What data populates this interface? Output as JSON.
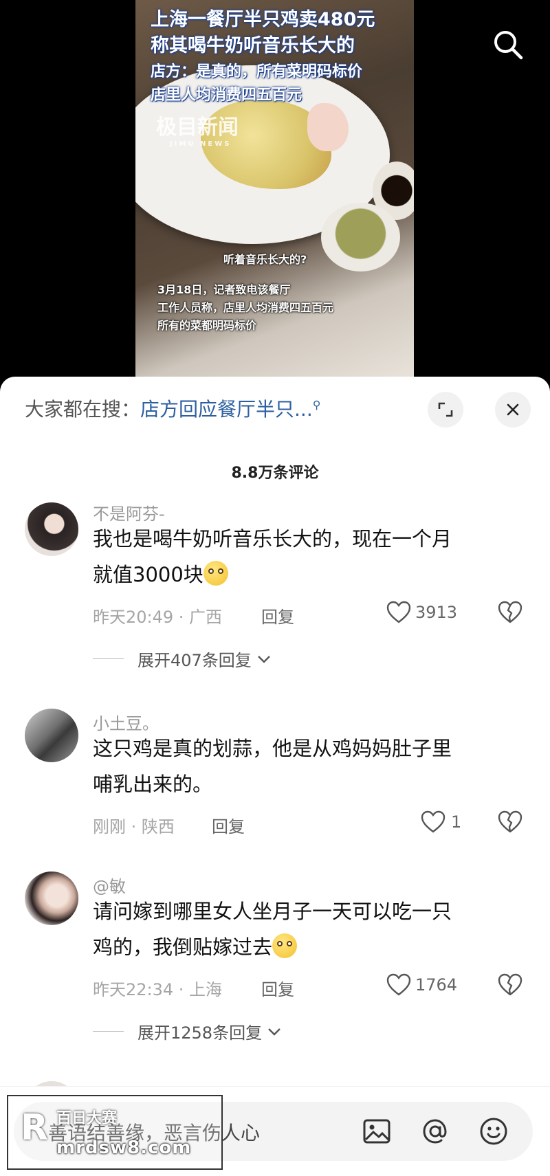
{
  "video": {
    "headline_line1": "上海一餐厅半只鸡卖480元",
    "headline_line2": "称其喝牛奶听音乐长大的",
    "sub_line1": "店方：是真的，所有菜明码标价",
    "sub_line2": "店里人均消费四五百元",
    "watermark_cn": "极目新闻",
    "watermark_en": "JIMU NEWS",
    "caption_question": "听着音乐长大的?",
    "caption_line1": "3月18日，记者致电该餐厅",
    "caption_line2": "工作人员称，店里人均消费四五百元",
    "caption_line3": "所有的菜都明码标价",
    "search_icon": "search-icon"
  },
  "sheet": {
    "hot_search_prefix": "大家都在搜：",
    "hot_search_query": "店方回应餐厅半只...",
    "expand_icon": "expand-icon",
    "close_icon": "close-icon",
    "comment_count": "8.8万条评论"
  },
  "comments": [
    {
      "username": "不是阿芬-",
      "text_line1": "我也是喝牛奶听音乐长大的，现在一个月",
      "text_line2": "就值3000块",
      "time_location": "昨天20:49 · 广西",
      "reply_label": "回复",
      "likes": "3913",
      "expand_label": "展开407条回复"
    },
    {
      "username": "小土豆。",
      "text_line1": "这只鸡是真的划蒜，他是从鸡妈妈肚子里",
      "text_line2": "哺乳出来的。",
      "time_location": "刚刚 · 陕西",
      "reply_label": "回复",
      "likes": "1"
    },
    {
      "username": "@敏",
      "text_line1": "请问嫁到哪里女人坐月子一天可以吃一只",
      "text_line2": "鸡的，我倒贴嫁过去",
      "time_location": "昨天22:34 · 上海",
      "reply_label": "回复",
      "likes": "1764",
      "expand_label": "展开1258条回复"
    }
  ],
  "input": {
    "placeholder": "善语结善缘，恶言伤人心",
    "icons": [
      "image-icon",
      "at-icon",
      "emoji-icon"
    ]
  },
  "site_watermark": {
    "letter": "R",
    "title": "百日大赛",
    "url": "mrdsw8.com"
  }
}
